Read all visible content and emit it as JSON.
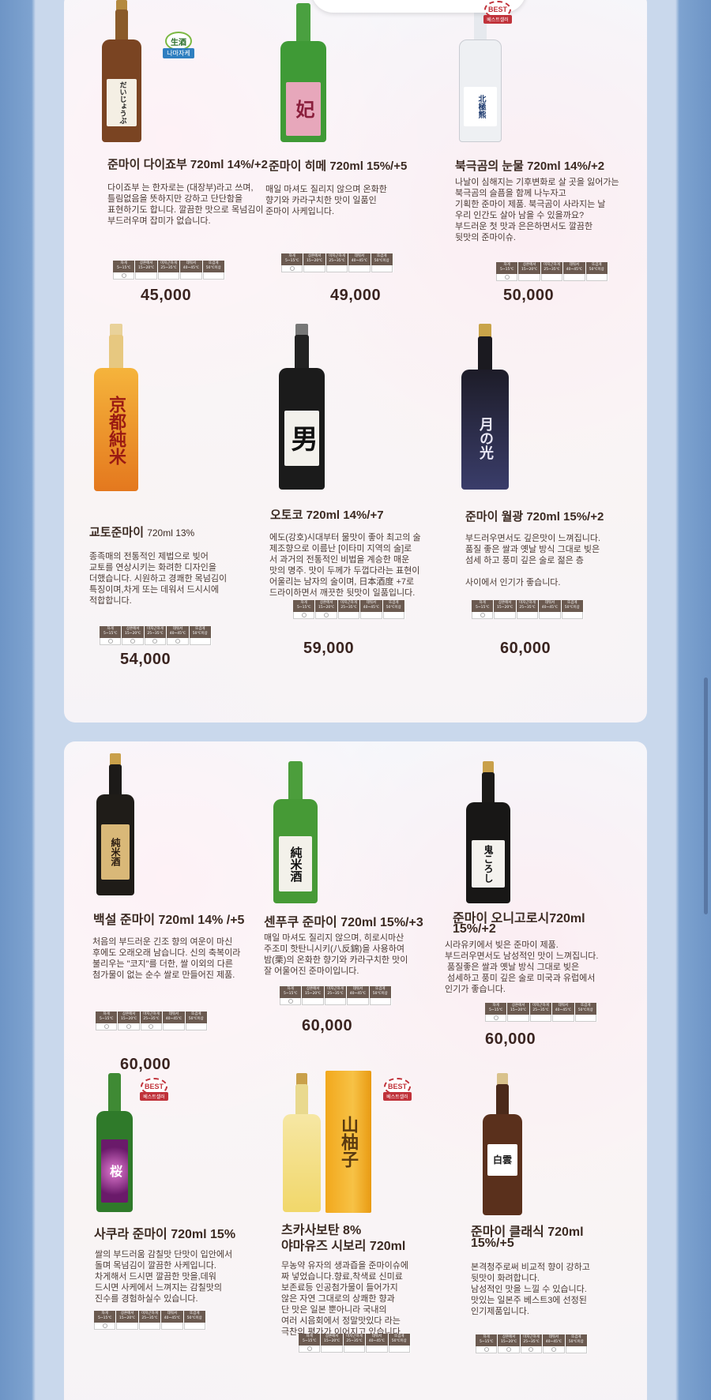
{
  "top_tab": {
    "label": ""
  },
  "colors": {
    "price": "#3a2420",
    "temp_header": "#6b5a50",
    "best_badge": "#c0323a",
    "nama_badge": "#2f7fc0"
  },
  "temp_table": {
    "headers": [
      "차게\n5~15℃",
      "상온에서\n15~20℃",
      "미지근하게\n25~35℃",
      "데워서\n40~45℃",
      "뜨겁게\n50℃이상"
    ]
  },
  "badges": {
    "best": "BEST",
    "best_sub": "베스트셀러",
    "nama_top": "生酒",
    "nama_bottom": "나마자케"
  },
  "products": [
    {
      "name": "준마이 다이죠부 720ml 14%/+2",
      "desc": "다이죠부 는 한자로는 (대장부)라고 쓰며,\n틀림없음을 뜻하지만 강하고 단단함을\n표현하기도 합니다. 깔끔한 맛으로 목넘김이\n부드러우며 잡미가 없습니다.",
      "price": "45,000"
    },
    {
      "name": "준마이 히메 720ml 15%/+5",
      "desc": "매일 마셔도 질리지 않으며 온화한\n향기와 카라구치한 맛이 일품인\n준마이 사케입니다.",
      "price": "49,000"
    },
    {
      "name": "북극곰의 눈물 720ml 14%/+2",
      "desc": "나날이 심해지는 기후변화로 살 곳을 잃어가는\n북극곰의 슬픔을 함께 나누자고\n기획한 준마이 제품. 북극곰이 사라지는 날\n우리 인간도 살아 남을 수 있을까요?\n부드러운 첫 맛과 은은하면서도 깔끔한\n뒷맛의 준마이슈.",
      "price": "50,000"
    },
    {
      "name": "교토준마이",
      "name_small": "720ml 13%",
      "desc": "종족매의 전통적인 제법으로 빚어\n교토를 연상시키는 화려한 디자인을\n더했습니다. 시원하고 경쾌한 목넘김이\n특징이며,차게 또는 데워서 드시시에\n적합합니다.",
      "price": "54,000"
    },
    {
      "name": "오토코 720ml 14%/+7",
      "desc": "에도(강호)시대부터 물맛이 좋아 최고의 술\n제조향으로 이름난 [이타미 지역의 술]로\n서 과거의 전통적인 비법을 계승한 매운\n맛의 명주. 맛이 두께가 두껍다라는 표현이\n어울리는 남자의 술이며, 日本酒度 +7로\n드라이하면서 깨끗한 뒷맛이 일품입니다.",
      "price": "59,000"
    },
    {
      "name": "준마이 월광 720ml 15%/+2",
      "desc": "부드러우면서도 깊은맛이 느껴집니다.\n품질 좋은 쌀과 옛날 방식 그대로 빚은\n섬세 하고 풍미 깊은 술로 젊은 층\n\n사이에서 인기가 좋습니다.",
      "price": "60,000"
    },
    {
      "name": "백설 준마이 720ml 14% /+5",
      "desc": "처음의 부드러운 긴조 향의 여운이 마신\n후에도 오래오래 남습니다. 신의 축복이라\n불리우는 \"코지\"를 더한, 쌀 이외의 다른\n첨가물이 없는 순수 쌀로 만들어진 제품.",
      "price": "60,000"
    },
    {
      "name": "센푸쿠 준마이 720ml 15%/+3",
      "desc": "매일 마셔도 질리지 않으며, 히로시마산\n주조미 핫탄니시키(八反錦)을 사용하여\n밤(栗)의 온화한 향기와 카라구치한 맛이\n잘 어울어진 준마이입니다.",
      "price": "60,000"
    },
    {
      "name": "준마이 오니고로시720ml",
      "name2": "15%/+2",
      "desc": "시라유키에서 빚은 준마이 제품.\n부드러우면서도 남성적인 맛이 느껴집니다.\n 품질좋은 쌀과 옛날 방식 그대로 빚은\n 섬세하고 풍미 깊은 술로 미국과 유럽에서\n인기가 좋습니다.",
      "price": "60,000"
    },
    {
      "name": "사쿠라 준마이 720ml 15%",
      "desc": "쌀의 부드러움 감칠맛 단맛이 입안에서\n돌며 목넘김이 깔끔한 사케입니다.\n차게해서 드시면 깔끔한 맛을,데워\n드시면 사케에서 느껴지는 감칠맛의\n진수를 경험하실수 있습니다.",
      "price": ""
    },
    {
      "name": "츠카사보탄 8%",
      "name2": "야마유즈 시보리 720ml",
      "desc": "무농약 유자의 생과즙을 준마이슈에\n짜 넣었습니다.향료,착색료 신미료\n보존료등 인공첨가물이 들어가지\n않은 자연 그대로의 상쾌한 향과\n단 맛은 일본 뿐아니라 국내의\n여러 시음회에서 정말맛있다 라는\n극찬의 평가가 이어지고 있습니다.",
      "price": ""
    },
    {
      "name": "준마이 클래식 720ml",
      "name2": "15%/+5",
      "desc": "본격청주로써 비교적 향이 강하고\n뒷맛이 화려합니다.\n남성적인 맛을 느낄 수 있습니다.\n맛있는 일본주 베스트3에 선정된\n인기제품입니다.",
      "price": ""
    }
  ],
  "bottle_labels": {
    "daijobu": "だいじょうぶ",
    "hime": "妃",
    "polar": "北極熊",
    "kyoto": "京都純米",
    "otoko": "男",
    "gekko": "月の光",
    "hakusetsu": "純米酒",
    "senpuku": "純米酒",
    "onikoroshi": "鬼ころし",
    "sakura": "桜",
    "yuzu_box": "山柚子",
    "hakuun": "白雲"
  }
}
